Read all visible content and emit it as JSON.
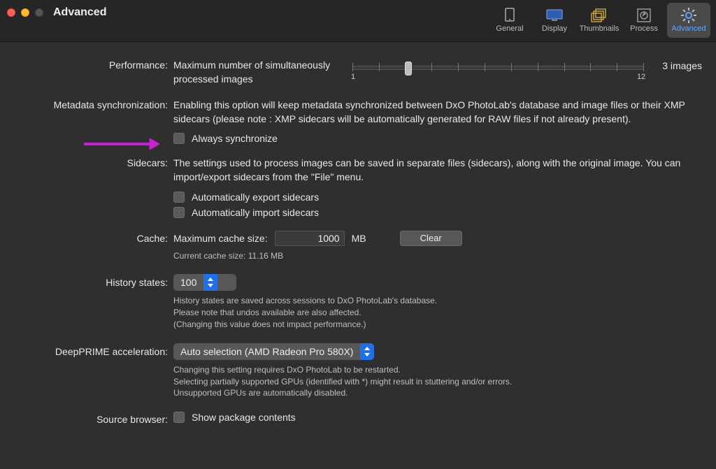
{
  "titlebar": {
    "title": "Advanced",
    "tabs": {
      "general": {
        "label": "General"
      },
      "display": {
        "label": "Display"
      },
      "thumbnails": {
        "label": "Thumbnails"
      },
      "process": {
        "label": "Process"
      },
      "advanced": {
        "label": "Advanced"
      }
    }
  },
  "performance": {
    "label": "Performance:",
    "text": "Maximum number of simultaneously processed images",
    "min_label": "1",
    "max_label": "12",
    "readout": "3 images"
  },
  "metadata": {
    "label": "Metadata synchronization:",
    "desc": "Enabling this option will keep metadata synchronized between DxO PhotoLab's database and image files or their XMP sidecars (please note : XMP sidecars will be automatically generated for RAW files if not already present).",
    "always_sync": "Always synchronize"
  },
  "sidecars": {
    "label": "Sidecars:",
    "desc": "The settings used to process images can be saved in separate files (sidecars), along with the original image. You can import/export sidecars from the \"File\" menu.",
    "export": "Automatically export sidecars",
    "import": "Automatically import sidecars"
  },
  "cache": {
    "label": "Cache:",
    "max_label": "Maximum cache size:",
    "value": "1000",
    "unit": "MB",
    "clear": "Clear",
    "current": "Current cache size: 11.16 MB"
  },
  "history": {
    "label": "History states:",
    "value": "100",
    "note1": "History states are saved across sessions to DxO PhotoLab's database.",
    "note2": "Please note that undos available are also affected.",
    "note3": "(Changing this value does not impact performance.)"
  },
  "deepprime": {
    "label": "DeepPRIME acceleration:",
    "value": "Auto selection (AMD Radeon Pro 580X)",
    "note1": "Changing this setting requires DxO PhotoLab to be restarted.",
    "note2": "Selecting partially supported GPUs (identified with *) might result in stuttering and/or errors.",
    "note3": "Unsupported GPUs are automatically disabled."
  },
  "source": {
    "label": "Source browser:",
    "show_pkg": "Show package contents"
  }
}
